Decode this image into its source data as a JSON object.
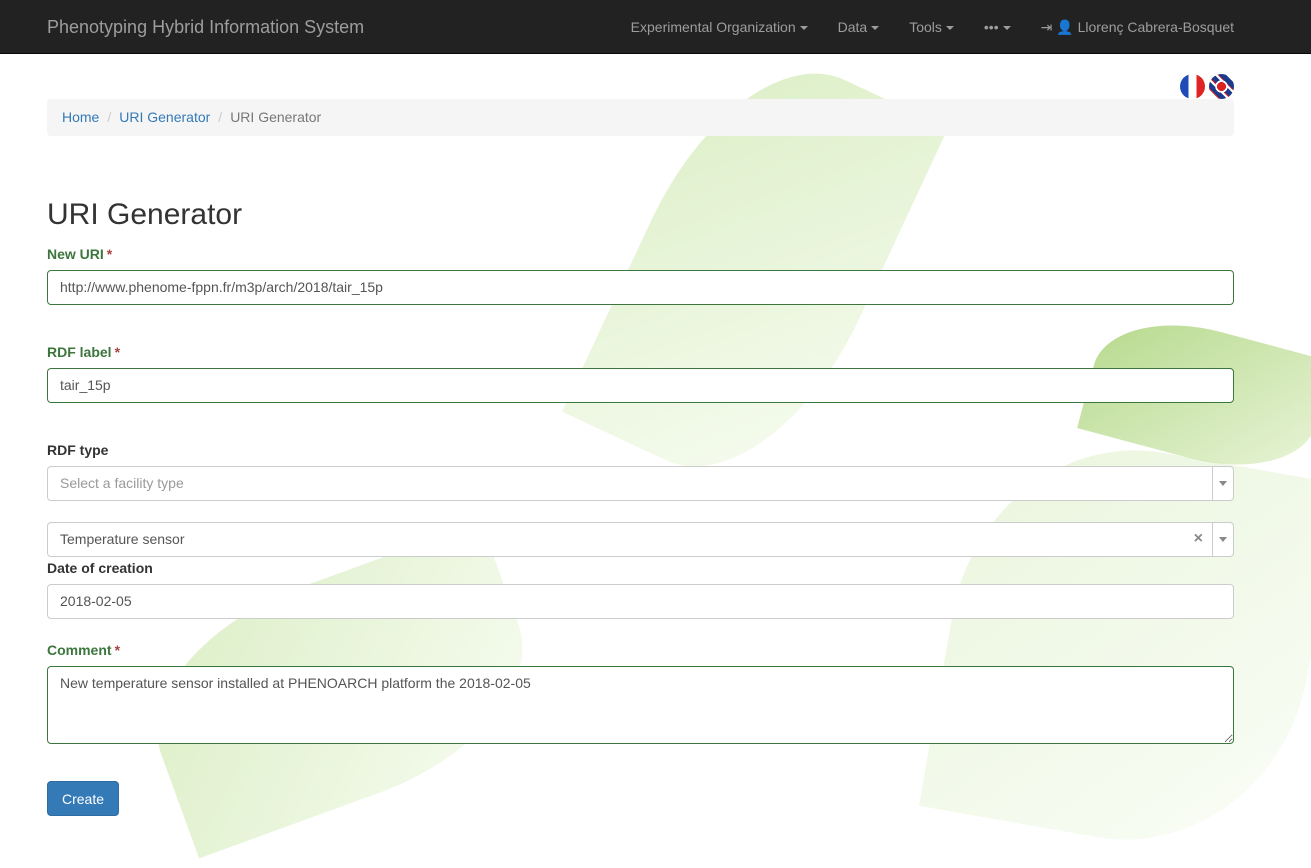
{
  "navbar": {
    "brand": "Phenotyping Hybrid Information System",
    "items": [
      "Experimental Organization",
      "Data",
      "Tools",
      "•••"
    ],
    "user": "Llorenç Cabrera-Bosquet"
  },
  "breadcrumb": [
    "Home",
    "URI Generator",
    "URI Generator"
  ],
  "page_title": "URI Generator",
  "form": {
    "new_uri": {
      "label": "New URI",
      "required": "*",
      "value": "http://www.phenome-fppn.fr/m3p/arch/2018/tair_15p"
    },
    "rdf_label": {
      "label": "RDF label",
      "required": "*",
      "value": "tair_15p"
    },
    "rdf_type": {
      "label": "RDF type",
      "placeholder": "Select a facility type",
      "selected": "Temperature sensor",
      "clear": "×"
    },
    "date": {
      "label": "Date of creation",
      "value": "2018-02-05"
    },
    "comment": {
      "label": "Comment",
      "required": "*",
      "value": "New temperature sensor installed at PHENOARCH platform the 2018-02-05"
    },
    "submit": "Create"
  }
}
